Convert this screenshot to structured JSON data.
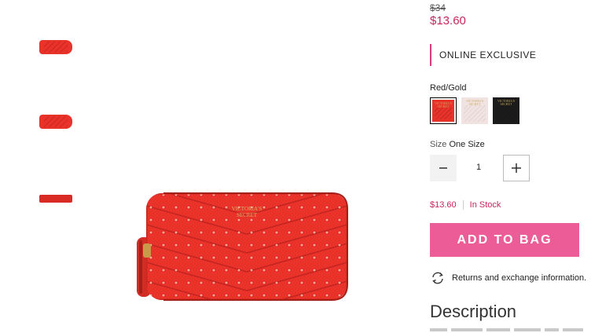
{
  "product": {
    "price_original": "$34",
    "price_sale": "$13.60",
    "badge": "ONLINE EXCLUSIVE",
    "brand_mark": "VICTORIA'S SECRET"
  },
  "color": {
    "selected_name": "Red/Gold",
    "swatches": [
      {
        "name": "red-gold",
        "color": "#e8322a",
        "selected": true
      },
      {
        "name": "blush",
        "color": "#f1e3e2",
        "selected": false
      },
      {
        "name": "black",
        "color": "#1b1b1b",
        "selected": false
      }
    ]
  },
  "size": {
    "label": "Size",
    "value": "One Size"
  },
  "quantity": {
    "value": "1"
  },
  "stock": {
    "price": "$13.60",
    "status": "In Stock"
  },
  "actions": {
    "add_to_bag": "ADD TO BAG",
    "returns": "Returns and exchange information."
  },
  "description": {
    "title": "Description"
  },
  "theme": {
    "accent": "#c8265a",
    "button": "#ec5d98",
    "wallet": "#e8322a"
  }
}
